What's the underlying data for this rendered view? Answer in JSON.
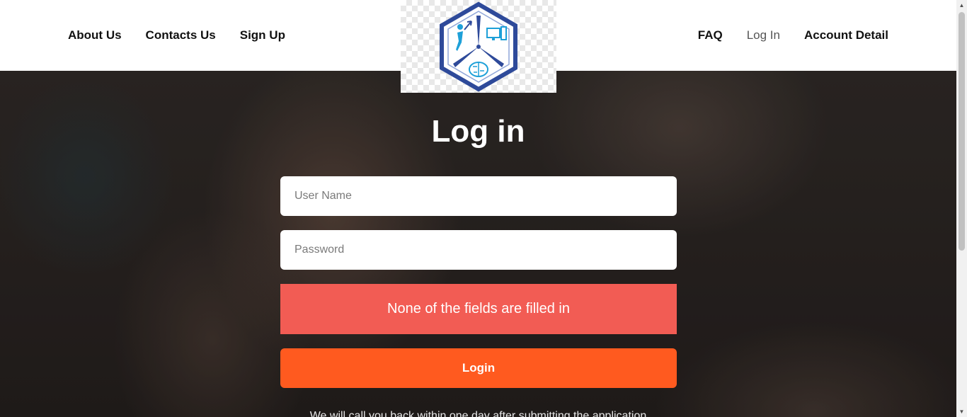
{
  "nav": {
    "left": [
      "About Us",
      "Contacts Us",
      "Sign Up"
    ],
    "right": [
      "FAQ",
      "Log In",
      "Account Detail"
    ],
    "active": "Log In"
  },
  "logo": {
    "icon": "hexagon-tech-logo"
  },
  "form": {
    "title": "Log in",
    "username_placeholder": "User Name",
    "password_placeholder": "Password",
    "error_message": "None of the fields are filled in",
    "submit_label": "Login",
    "callback_note": "We will call you back within one day after submitting the application"
  },
  "colors": {
    "error": "#f25c54",
    "accent": "#ff5a1f",
    "logo_blue": "#2e4a9a",
    "logo_cyan": "#1ea0d8"
  }
}
